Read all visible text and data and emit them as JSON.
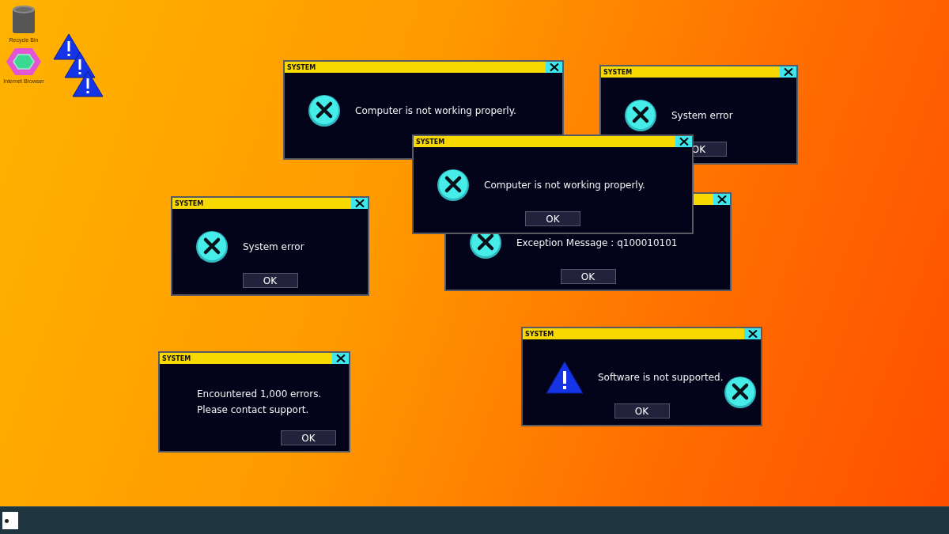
{
  "desktop_icons": [
    {
      "label": "Recycle Bin",
      "kind": "bin"
    },
    {
      "label": "Internet Browser",
      "kind": "browser"
    }
  ],
  "windows": [
    {
      "title": "SYSTEM",
      "kind": "error",
      "lines": [
        "Computer is not working properly."
      ]
    },
    {
      "title": "SYSTEM",
      "kind": "error",
      "lines": [
        "System error"
      ],
      "button": "OK"
    },
    {
      "kind": "error",
      "lines": [
        "Exception Message : q100010101"
      ],
      "button": "OK"
    },
    {
      "title": "SYSTEM",
      "kind": "error",
      "lines": [
        "Computer is not working properly."
      ],
      "button": "OK"
    },
    {
      "title": "SYSTEM",
      "kind": "error",
      "lines": [
        "System error"
      ],
      "button": "OK"
    },
    {
      "title": "SYSTEM",
      "kind": "plain",
      "lines": [
        "Encountered 1,000 errors.",
        "Please contact support."
      ],
      "button": "OK"
    },
    {
      "title": "SYSTEM",
      "kind": "warning",
      "lines": [
        "Software is not supported."
      ],
      "button": "OK"
    }
  ]
}
